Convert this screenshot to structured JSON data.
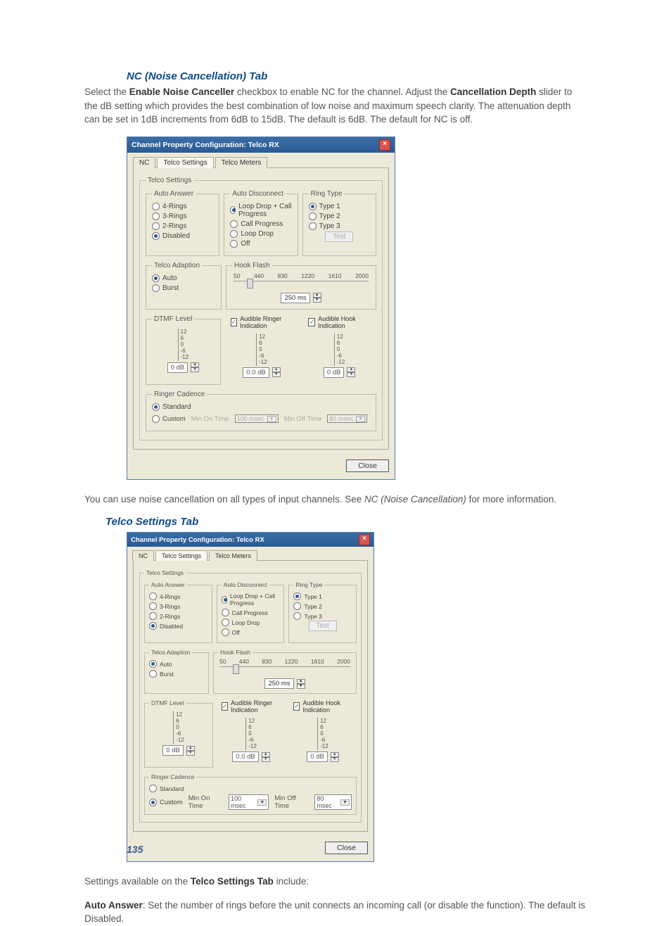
{
  "page_number": "135",
  "sections": {
    "nc_heading": "NC (Noise Cancellation) Tab",
    "nc_para_pre": "Select the ",
    "nc_para_b1": "Enable Noise Canceller",
    "nc_para_mid": " checkbox to enable NC for the channel. Adjust the ",
    "nc_para_b2": "Cancellation Depth",
    "nc_para_post": " slider to the dB setting which provides the best combination of low noise and maximum speech clarity. The attenuation depth can be set in 1dB increments from 6dB to 15dB. The default is 6dB. The default for NC is off.",
    "nc_para2_pre": "You can use noise cancellation on all types of input channels. See ",
    "nc_para2_i": "NC (Noise Cancellation)",
    "nc_para2_post": " for more information.",
    "telco_heading": "Telco Settings Tab",
    "telco_settings_pre": "Settings available on the ",
    "telco_settings_b": "Telco Settings Tab",
    "telco_settings_post": " include:",
    "auto_answer_b": "Auto Answer",
    "auto_answer_text": ": Set the number of rings before the unit connects an incoming call (or disable the function). The default is Disabled."
  },
  "dialog": {
    "title": "Channel Property Configuration: Telco RX",
    "tabs": {
      "nc": "NC",
      "telco_settings": "Telco Settings",
      "telco_meters": "Telco Meters"
    },
    "groups": {
      "telco_settings": "Telco Settings",
      "auto_answer": "Auto Answer",
      "auto_disconnect": "Auto Disconnect",
      "ring_type": "Ring Type",
      "telco_adaption": "Telco Adaption",
      "hook_flash": "Hook Flash",
      "dtmf_level": "DTMF Level",
      "ringer_cadence": "Ringer Cadence"
    },
    "auto_answer_opts": {
      "r4": "4-Rings",
      "r3": "3-Rings",
      "r2": "2-Rings",
      "dis": "Disabled"
    },
    "auto_disc_opts": {
      "ldcp": "Loop Drop + Call Progress",
      "cp": "Call Progress",
      "ld": "Loop Drop",
      "off": "Off"
    },
    "ring_type_opts": {
      "t1": "Type 1",
      "t2": "Type 2",
      "t3": "Type 3",
      "test": "Test"
    },
    "telco_adaption_opts": {
      "auto": "Auto",
      "burst": "Burst"
    },
    "hookflash": {
      "ticks": [
        "50",
        "440",
        "830",
        "1220",
        "1610",
        "2000"
      ],
      "value": "250 ms"
    },
    "dtmf_value": "0 dB",
    "ari_label": "Audible Ringer Indication",
    "ari_value": "0.0 dB",
    "ahi_label": "Audible Hook Indication",
    "ahi_value": "0 dB",
    "scale": {
      "p12": "12",
      "p6": "6",
      "z": "0",
      "n6": "-6",
      "n12": "-12"
    },
    "ringer_opts": {
      "std": "Standard",
      "custom": "Custom"
    },
    "min_on": "Min On Time",
    "min_on_val": "100 msec",
    "min_off": "Min Off Time",
    "min_off_val": "80 msec",
    "close": "Close"
  },
  "dialog2": {
    "ringer_selected": "custom",
    "dtmf_value": "0 dB"
  }
}
